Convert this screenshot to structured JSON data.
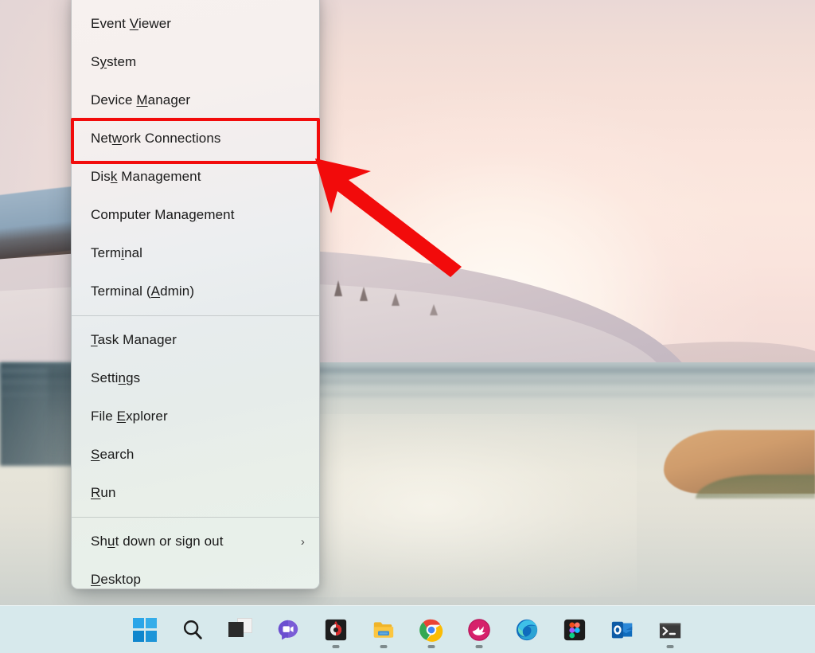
{
  "desktop": {
    "wallpaper_name": "lake-sunset-wallpaper",
    "sky_color": "#fae4dc",
    "water_color": "#e3e1d7",
    "reed_color": "#cf9c6c"
  },
  "context_menu": {
    "name": "Windows Power User menu (Win+X)",
    "groups": [
      {
        "items": [
          {
            "label": "Event Viewer",
            "accesskey": "V",
            "pre": "Event ",
            "post": "iewer"
          },
          {
            "label": "System",
            "accesskey": "y",
            "pre": "S",
            "post": "stem"
          },
          {
            "label": "Device Manager",
            "accesskey": "M",
            "pre": "Device ",
            "post": "anager"
          },
          {
            "label": "Network Connections",
            "accesskey": "w",
            "pre": "Net",
            "post": "ork Connections",
            "highlighted": true
          },
          {
            "label": "Disk Management",
            "accesskey": "k",
            "pre": "Dis",
            "post": " Management"
          },
          {
            "label": "Computer Management",
            "accesskey": "g",
            "pre": "Computer Mana",
            "post": "ement"
          },
          {
            "label": "Terminal",
            "accesskey": "i",
            "pre": "Term",
            "post": "nal"
          },
          {
            "label": "Terminal (Admin)",
            "accesskey": "A",
            "pre": "Terminal (",
            "post": "dmin)"
          }
        ]
      },
      {
        "items": [
          {
            "label": "Task Manager",
            "accesskey": "T",
            "pre": "",
            "post": "ask Manager"
          },
          {
            "label": "Settings",
            "accesskey": "n",
            "pre": "Setti",
            "post": "gs"
          },
          {
            "label": "File Explorer",
            "accesskey": "E",
            "pre": "File ",
            "post": "xplorer"
          },
          {
            "label": "Search",
            "accesskey": "S",
            "pre": "",
            "post": "earch"
          },
          {
            "label": "Run",
            "accesskey": "R",
            "pre": "",
            "post": "un"
          }
        ]
      },
      {
        "items": [
          {
            "label": "Shut down or sign out",
            "accesskey": "u",
            "pre": "Sh",
            "post": "t down or sign out",
            "submenu": true,
            "chevron": "›"
          },
          {
            "label": "Desktop",
            "accesskey": "D",
            "pre": "",
            "post": "esktop"
          }
        ]
      }
    ]
  },
  "annotations": {
    "highlight_color": "#f20b0b",
    "highlight_target": "Network Connections",
    "arrow_color": "#f20b0b",
    "arrow_points_to": "Network Connections"
  },
  "taskbar": {
    "background_color": "#d7e9ec",
    "items": [
      {
        "name": "start-button",
        "icon": "windows-logo-icon",
        "running": false
      },
      {
        "name": "search-button",
        "icon": "search-icon",
        "running": false
      },
      {
        "name": "task-view-button",
        "icon": "task-view-icon",
        "running": false
      },
      {
        "name": "chat-button",
        "icon": "chat-video-icon",
        "running": false
      },
      {
        "name": "screen-recorder-button",
        "icon": "recorder-icon",
        "running": true
      },
      {
        "name": "file-explorer-button",
        "icon": "folder-icon",
        "running": true
      },
      {
        "name": "chrome-button",
        "icon": "chrome-icon",
        "running": true
      },
      {
        "name": "app-pink-button",
        "icon": "pink-bird-icon",
        "running": true
      },
      {
        "name": "edge-button",
        "icon": "edge-icon",
        "running": false
      },
      {
        "name": "figma-button",
        "icon": "figma-icon",
        "running": false
      },
      {
        "name": "outlook-button",
        "icon": "outlook-icon",
        "running": false
      },
      {
        "name": "terminal-button",
        "icon": "terminal-icon",
        "running": true
      }
    ]
  }
}
